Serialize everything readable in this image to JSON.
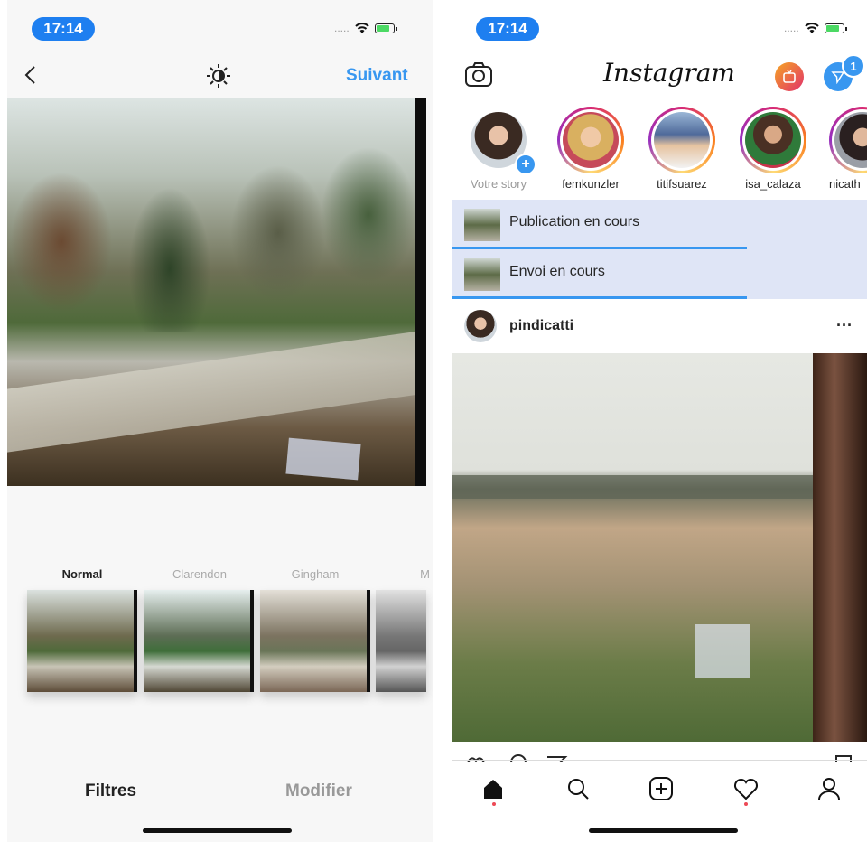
{
  "left": {
    "status": {
      "time": "17:14",
      "signal": "....."
    },
    "header": {
      "back_icon": "chevron-left-icon",
      "adjust_icon": "brightness-icon",
      "next_label": "Suivant"
    },
    "filters": [
      {
        "name": "Normal",
        "selected": true
      },
      {
        "name": "Clarendon",
        "selected": false
      },
      {
        "name": "Gingham",
        "selected": false
      },
      {
        "name": "M",
        "selected": false
      }
    ],
    "bottom_tabs": {
      "filters_label": "Filtres",
      "edit_label": "Modifier"
    }
  },
  "right": {
    "status": {
      "time": "17:14",
      "signal": "....."
    },
    "header": {
      "logo": "Instagram",
      "dm_badge": "1",
      "camera_icon": "camera-icon",
      "igtv_icon": "igtv-icon",
      "dm_icon": "direct-message-icon"
    },
    "stories": [
      {
        "name": "Votre story",
        "own": true
      },
      {
        "name": "femkunzler",
        "own": false
      },
      {
        "name": "titifsuarez",
        "own": false
      },
      {
        "name": "isa_calaza",
        "own": false
      },
      {
        "name": "nicath",
        "own": false
      }
    ],
    "uploads": [
      {
        "label": "Publication en cours",
        "progress": 0.71
      },
      {
        "label": "Envoi en cours",
        "progress": 0.71
      }
    ],
    "post": {
      "username": "pindicatti",
      "more": "···"
    },
    "tabbar": [
      "home-icon",
      "search-icon",
      "add-post-icon",
      "activity-heart-icon",
      "profile-icon"
    ]
  },
  "colors": {
    "accent": "#3897f0",
    "status_pill": "#1e7ff0",
    "upload_bg": "#dfe5f6"
  }
}
